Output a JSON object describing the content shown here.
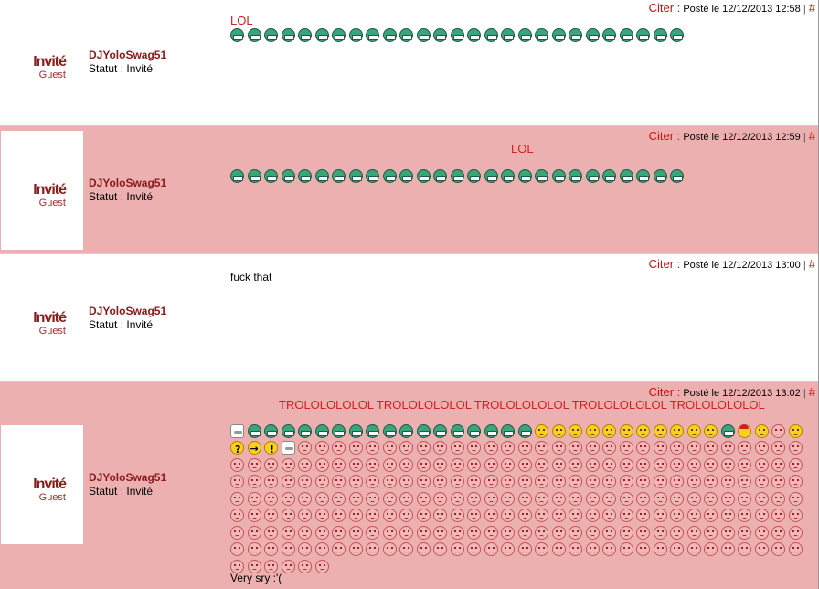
{
  "thread": {
    "posts": [
      {
        "meta": {
          "quote_label": "Citer :",
          "posted_label": "Posté le 12/12/2013 12:58",
          "sep": "|",
          "anchor": "#"
        },
        "author": "DJYoloSwag51",
        "status": "Statut : Invité",
        "badge": {
          "line1": "Invité",
          "line2": "Guest"
        },
        "message_title": "LOL",
        "message_text": "",
        "smileys": [
          "green",
          "green",
          "green",
          "green",
          "green",
          "green",
          "green",
          "green",
          "green",
          "green",
          "green",
          "green",
          "green",
          "green",
          "green",
          "green",
          "green",
          "green",
          "green",
          "green",
          "green",
          "green",
          "green",
          "green",
          "green",
          "green",
          "green"
        ]
      },
      {
        "meta": {
          "quote_label": "Citer :",
          "posted_label": "Posté le 12/12/2013 12:59",
          "sep": "|",
          "anchor": "#"
        },
        "author": "DJYoloSwag51",
        "status": "Statut : Invité",
        "badge": {
          "line1": "Invité",
          "line2": "Guest"
        },
        "message_title": "LOL",
        "message_text": "",
        "smileys": [
          "green",
          "green",
          "green",
          "green",
          "green",
          "green",
          "green",
          "green",
          "green",
          "green",
          "green",
          "green",
          "green",
          "green",
          "green",
          "green",
          "green",
          "green",
          "green",
          "green",
          "green",
          "green",
          "green",
          "green",
          "green",
          "green",
          "green"
        ]
      },
      {
        "meta": {
          "quote_label": "Citer :",
          "posted_label": "Posté le 12/12/2013 13:00",
          "sep": "|",
          "anchor": "#"
        },
        "author": "DJYoloSwag51",
        "status": "Statut : Invité",
        "badge": {
          "line1": "Invité",
          "line2": "Guest"
        },
        "message_title": "",
        "message_text": "fuck that",
        "smileys": []
      },
      {
        "meta": {
          "quote_label": "Citer :",
          "posted_label": "Posté le 12/12/2013 13:02",
          "sep": "|",
          "anchor": "#"
        },
        "author": "DJYoloSwag51",
        "status": "Statut : Invité",
        "badge": {
          "line1": "Invité",
          "line2": "Guest"
        },
        "message_title": "TROLOLOLOLOL TROLOLOLOLOL TROLOLOLOLOL TROLOLOLOLOL TROLOLOLOLOL",
        "message_text": "Very sry :'(",
        "smileys_first_row": [
          "hand",
          "green",
          "green",
          "green",
          "green",
          "green",
          "green",
          "green",
          "green",
          "green",
          "green",
          "green",
          "green",
          "green",
          "green",
          "green",
          "green",
          "green",
          "yellow",
          "yellow",
          "yellow",
          "yellow",
          "yellow",
          "yellow",
          "yellow",
          "yellow",
          "yellow",
          "yellow",
          "yellow",
          "green",
          "santa",
          "yellow",
          "sad",
          "yellow"
        ],
        "smileys_second_row_prefix": [
          "question",
          "arrow",
          "excl",
          "hand"
        ],
        "sad_count": 240
      }
    ]
  },
  "colors": {
    "pink_bg": "#edb0b0",
    "author": "#8b1a1a",
    "red_text": "#d02020"
  }
}
